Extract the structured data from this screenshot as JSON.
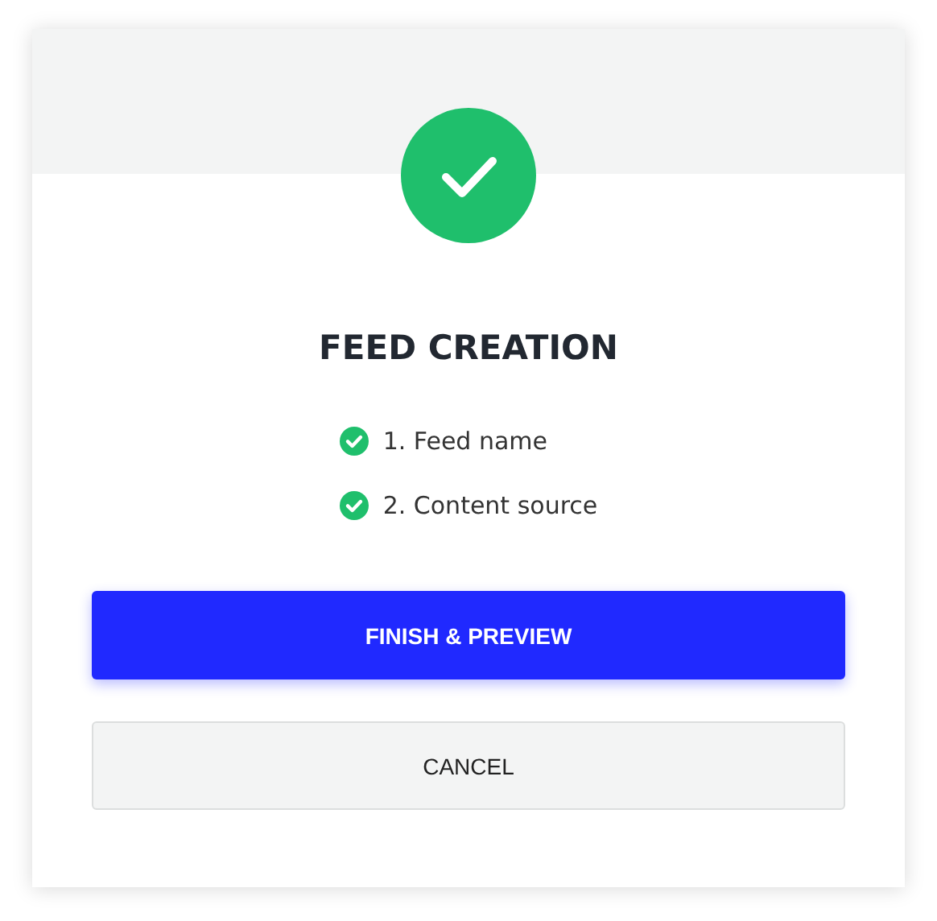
{
  "title": "FEED CREATION",
  "steps": [
    {
      "label": "1. Feed name",
      "checked": true
    },
    {
      "label": "2. Content source",
      "checked": true
    }
  ],
  "buttons": [
    {
      "label": "FINISH & PREVIEW",
      "kind": "primary"
    },
    {
      "label": "CANCEL",
      "kind": "secondary"
    }
  ]
}
